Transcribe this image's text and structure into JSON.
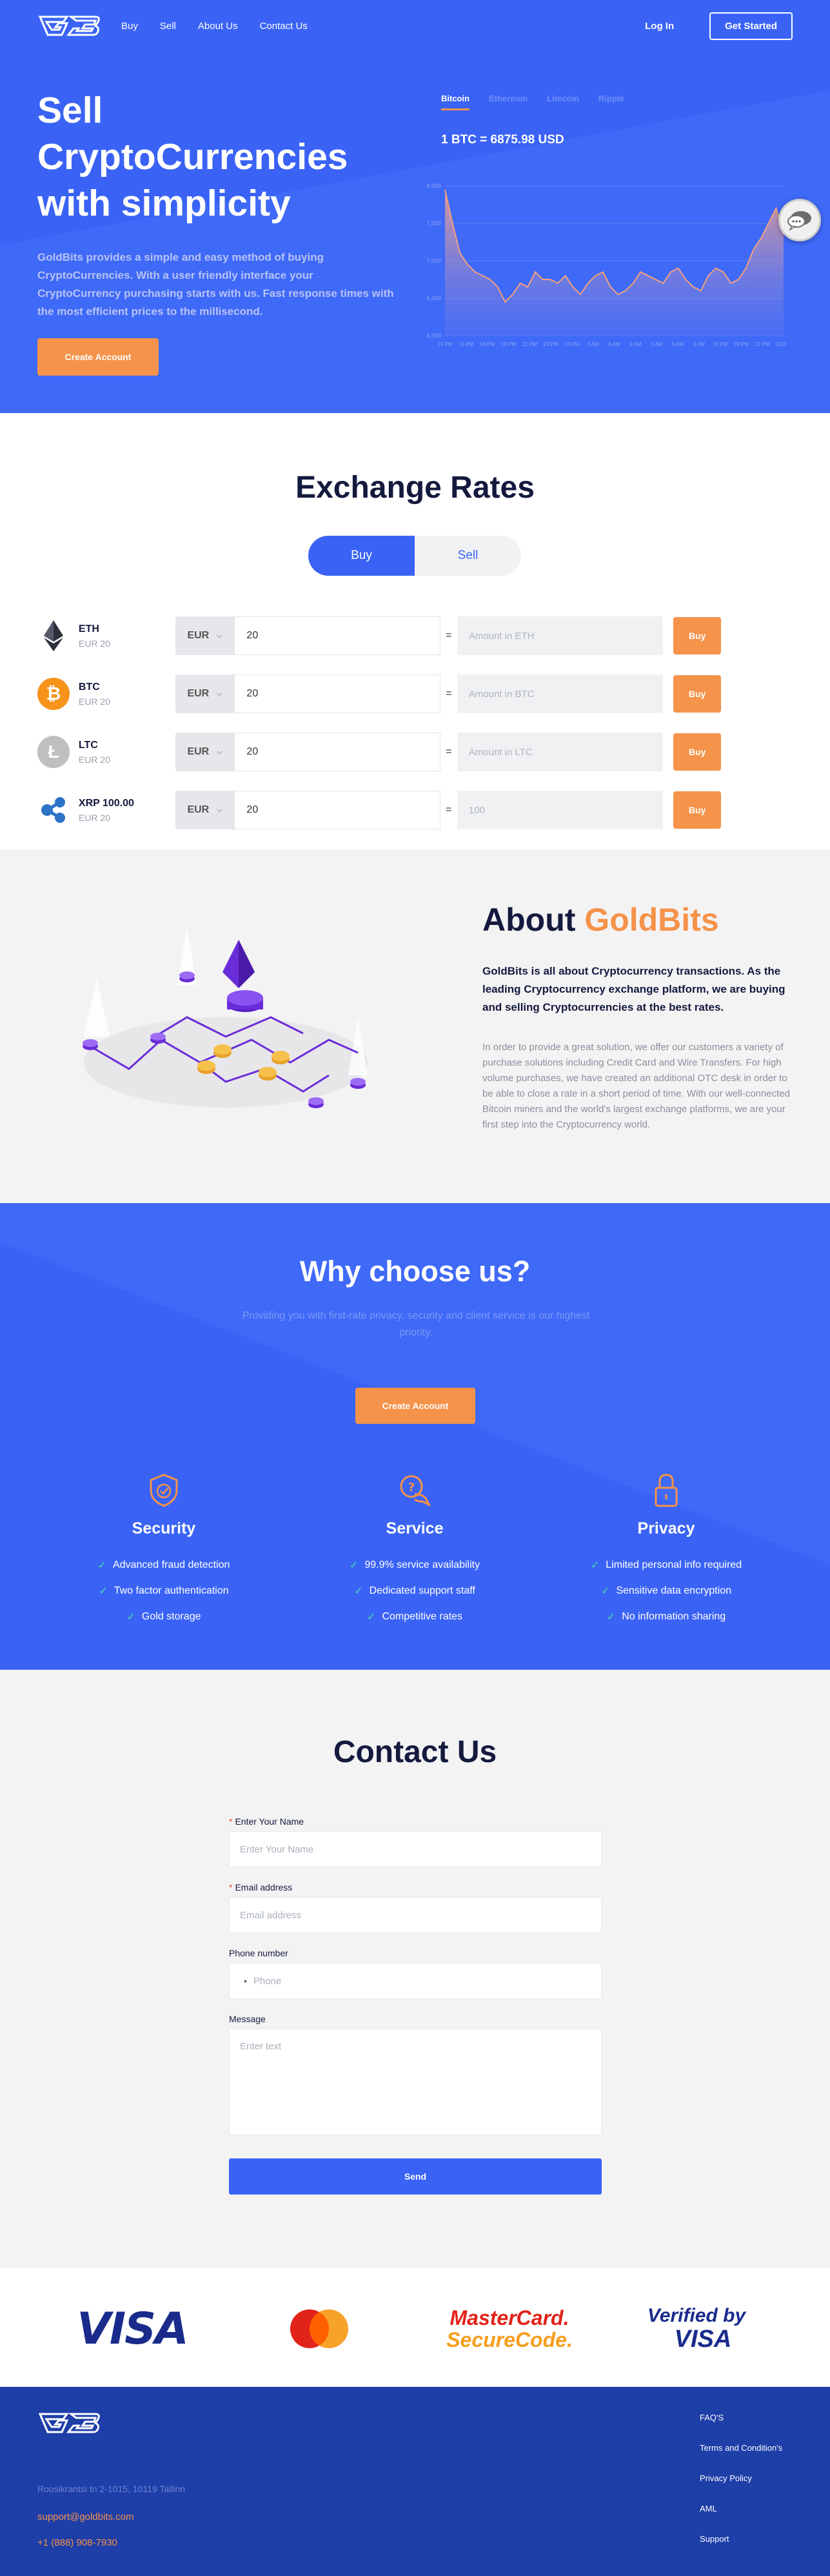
{
  "nav": {
    "links": [
      "Buy",
      "Sell",
      "About Us",
      "Contact Us"
    ],
    "login": "Log In",
    "get_started": "Get Started"
  },
  "hero": {
    "title": "Sell CryptoCurrencies with simplicity",
    "description": "GoldBits provides a simple and easy method of buying CryptoCurrencies. With a user friendly interface your CryptoCurrency purchasing starts with us. Fast response times with the most efficient prices to the millisecond.",
    "cta": "Create Account",
    "coin_tabs": [
      "Bitcoin",
      "Ethereum",
      "Litecoin",
      "Ripple"
    ],
    "active_tab": "Bitcoin",
    "price": "1 BTC = 6875.98 USD"
  },
  "chart_data": {
    "type": "area",
    "y_ticks": [
      "8,000",
      "7,500",
      "7,000",
      "6,500",
      "6,000"
    ],
    "ylim": [
      6000,
      8000
    ],
    "x_labels": [
      "15 PM",
      "16 PM",
      "18 PM",
      "19 PM",
      "21 PM",
      "22 PM",
      "23 PM",
      "3 AM",
      "6 AM",
      "9 AM",
      "3 AM",
      "6 AM",
      "9 AM",
      "16 PM",
      "19 PM",
      "22 PM",
      "23 PM"
    ],
    "values": [
      7950,
      7500,
      7100,
      6950,
      6850,
      6800,
      6750,
      6650,
      6450,
      6550,
      6700,
      6650,
      6850,
      6750,
      6750,
      6700,
      6800,
      6650,
      6550,
      6700,
      6800,
      6850,
      6650,
      6550,
      6600,
      6700,
      6850,
      6800,
      6750,
      6700,
      6850,
      6900,
      6750,
      6650,
      6600,
      6800,
      6900,
      6850,
      6700,
      6750,
      6900,
      7150,
      7300,
      7500,
      7700,
      7350
    ]
  },
  "exchange": {
    "title": "Exchange Rates",
    "tabs": [
      "Buy",
      "Sell"
    ],
    "rows": [
      {
        "symbol": "ETH",
        "sub": "EUR 20",
        "currency": "EUR",
        "amount": "20",
        "placeholder": "Amount in ETH",
        "button": "Buy",
        "color": "#2d2f3a"
      },
      {
        "symbol": "BTC",
        "sub": "EUR 20",
        "currency": "EUR",
        "amount": "20",
        "placeholder": "Amount in BTC",
        "button": "Buy",
        "color": "#f7931a"
      },
      {
        "symbol": "LTC",
        "sub": "EUR 20",
        "currency": "EUR",
        "amount": "20",
        "placeholder": "Amount in LTC",
        "button": "Buy",
        "color": "#bfbfbf"
      },
      {
        "symbol": "XRP 100.00",
        "sub": "EUR 20",
        "currency": "EUR",
        "amount": "20",
        "placeholder": "100",
        "button": "Buy",
        "color": "#2d73c7"
      }
    ]
  },
  "about": {
    "title_prefix": "About",
    "title_accent": "GoldBits",
    "lead": "GoldBits is all about Cryptocurrency transactions. As the leading Cryptocurrency exchange platform, we are buying and selling Cryptocurrencies at the best rates.",
    "body": "In order to provide a great solution, we offer our customers a variety of purchase solutions including Credit Card and Wire Transfers. For high volume purchases, we have created an additional OTC desk in order to be able to close a rate in a short period of time. With our well-connected Bitcoin miners and the world's largest exchange platforms, we are your first step into the Cryptocurrency world."
  },
  "why": {
    "title": "Why choose us?",
    "subtitle": "Providing you with first-rate privacy, security and client service is our highest priority.",
    "cta": "Create Account",
    "features": [
      {
        "title": "Security",
        "icon": "shield-icon",
        "items": [
          "Advanced fraud detection",
          "Two factor authentication",
          "Gold storage"
        ]
      },
      {
        "title": "Service",
        "icon": "support-chat-icon",
        "items": [
          "99.9% service availability",
          "Dedicated support staff",
          "Competitive rates"
        ]
      },
      {
        "title": "Privacy",
        "icon": "lock-icon",
        "items": [
          "Limited personal info required",
          "Sensitive data encryption",
          "No information sharing"
        ]
      }
    ]
  },
  "contact": {
    "title": "Contact Us",
    "name_label": "Enter Your Name",
    "name_placeholder": "Enter Your Name",
    "email_label": "Email address",
    "email_placeholder": "Email address",
    "phone_label": "Phone number",
    "phone_placeholder": "Phone",
    "message_label": "Message",
    "message_placeholder": "Enter text",
    "send": "Send"
  },
  "payments": {
    "visa": "VISA",
    "mastercard_securecode_line1": "MasterCard.",
    "mastercard_securecode_line2": "SecureCode.",
    "verified_line1": "Verified by",
    "verified_line2": "VISA"
  },
  "footer": {
    "address": "Roosikrantsi tn 2-1015, 10119 Tallinn",
    "email": "support@goldbits.com",
    "phone": "+1 (888) 908-7930",
    "links": [
      "FAQ'S",
      "Terms and Condition's",
      "Privacy Policy",
      "AML",
      "Support"
    ]
  },
  "colors": {
    "primary": "#3a63f5",
    "accent": "#f5934a",
    "dark": "#141a3e",
    "footer": "#1e3ea8",
    "check": "#3fe1a6"
  }
}
